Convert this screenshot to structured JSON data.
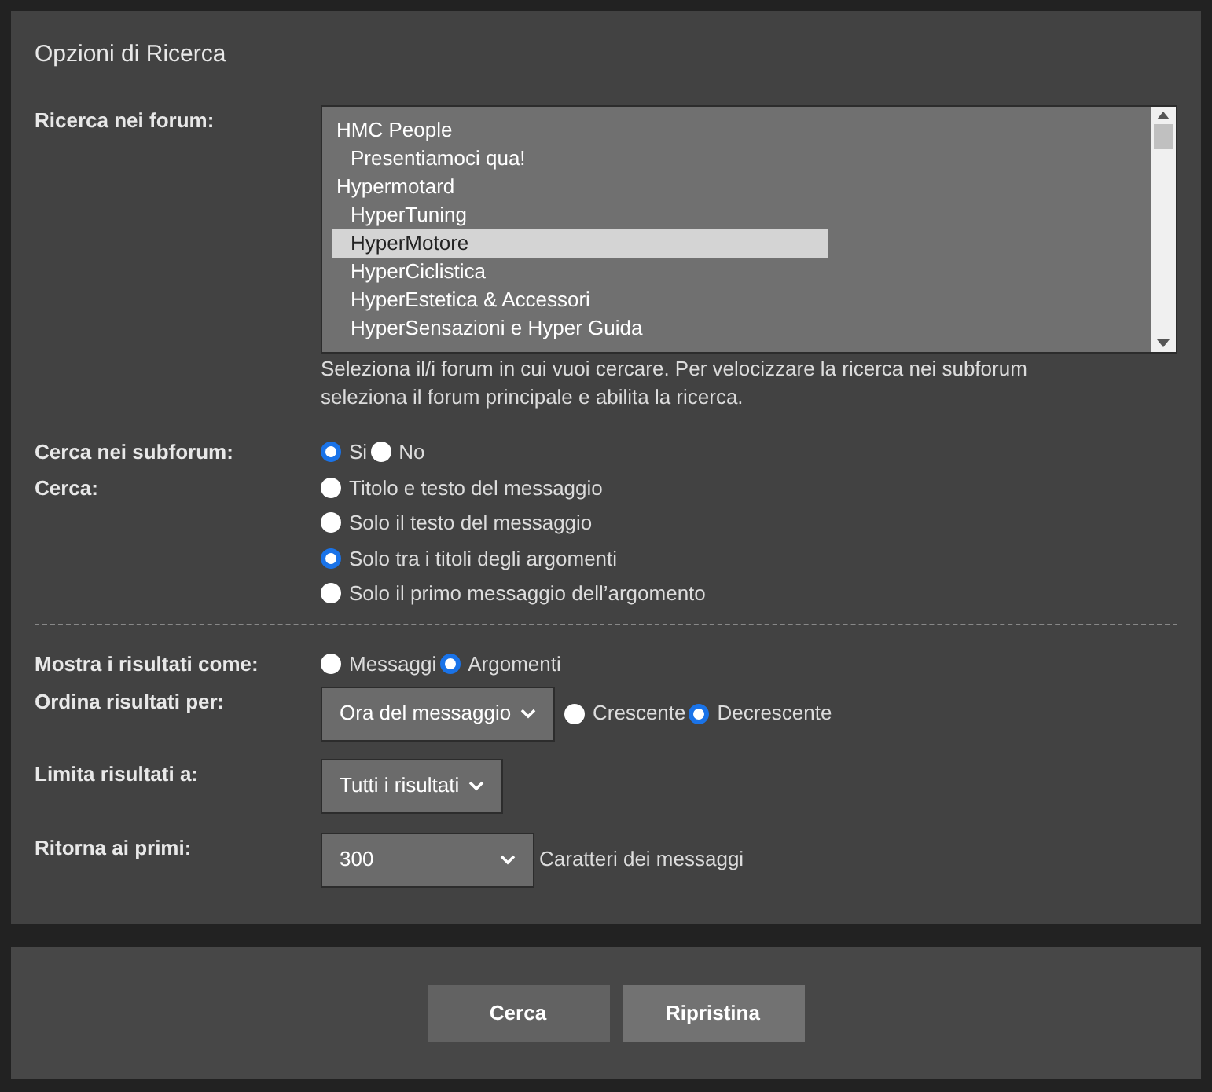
{
  "title": "Opzioni di Ricerca",
  "forum_field": {
    "label": "Ricerca nei forum:",
    "items": [
      {
        "label": "HMC People",
        "selected": false,
        "children": [
          {
            "label": "Presentiamoci qua!",
            "selected": false
          }
        ]
      },
      {
        "label": "Hypermotard",
        "selected": false,
        "children": [
          {
            "label": "HyperTuning",
            "selected": false
          },
          {
            "label": "HyperMotore",
            "selected": true
          },
          {
            "label": "HyperCiclistica",
            "selected": false
          },
          {
            "label": "HyperEstetica & Accessori",
            "selected": false
          },
          {
            "label": "HyperSensazioni e Hyper Guida",
            "selected": false
          }
        ]
      }
    ],
    "help": "Seleziona il/i forum in cui vuoi cercare. Per velocizzare la ricerca nei subforum seleziona il forum principale e abilita la ricerca."
  },
  "subforum": {
    "label": "Cerca nei subforum:",
    "options": [
      {
        "label": "Si",
        "selected": true
      },
      {
        "label": "No",
        "selected": false
      }
    ]
  },
  "search_in": {
    "label": "Cerca:",
    "options": [
      {
        "label": "Titolo e testo del messaggio",
        "selected": false
      },
      {
        "label": "Solo il testo del messaggio",
        "selected": false
      },
      {
        "label": "Solo tra i titoli degli argomenti",
        "selected": true
      },
      {
        "label": "Solo il primo messaggio dell’argomento",
        "selected": false
      }
    ]
  },
  "show_as": {
    "label": "Mostra i risultati come:",
    "options": [
      {
        "label": "Messaggi",
        "selected": false
      },
      {
        "label": "Argomenti",
        "selected": true
      }
    ]
  },
  "sort": {
    "label": "Ordina risultati per:",
    "value": "Ora del messaggio",
    "options": [
      {
        "label": "Crescente",
        "selected": false
      },
      {
        "label": "Decrescente",
        "selected": true
      }
    ]
  },
  "limit": {
    "label": "Limita risultati a:",
    "value": "Tutti i risultati"
  },
  "return": {
    "label": "Ritorna ai primi:",
    "value": "300",
    "suffix": "Caratteri dei messaggi"
  },
  "buttons": [
    {
      "label": "Cerca",
      "kind": "primary"
    },
    {
      "label": "Ripristina",
      "kind": "secondary"
    }
  ]
}
